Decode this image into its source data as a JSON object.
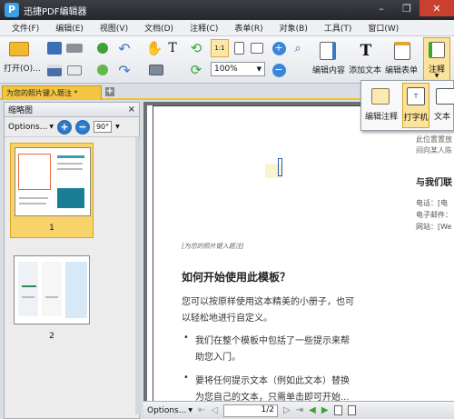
{
  "window": {
    "app_logo": "P",
    "title": "迅捷PDF编辑器"
  },
  "menu": [
    "文件(F)",
    "编辑(E)",
    "视图(V)",
    "文档(D)",
    "注释(C)",
    "表单(R)",
    "对象(B)",
    "工具(T)",
    "窗口(W)"
  ],
  "toolbar": {
    "open_label": "打开(O)...",
    "zoom_value": "100%",
    "edit_content_label": "编辑内容",
    "add_text_label": "添加文本",
    "edit_form_label": "编辑表单",
    "annotate_label": "注释"
  },
  "annotate_popup": {
    "edit_annotation_label": "编辑注释",
    "typewriter_label": "打字机",
    "text_label": "文本"
  },
  "tabs": {
    "active_tab": "为您的照片键入题注 *",
    "add_tab": "+"
  },
  "sidebar": {
    "title": "缩略图",
    "close": "×",
    "options_label": "Options...",
    "zoom_in": "+",
    "zoom_out": "−",
    "rotate_label": "90°",
    "thumbnails": [
      {
        "page": "1"
      },
      {
        "page": "2"
      }
    ]
  },
  "document": {
    "caption_placeholder": "[为您的照片键入题注]",
    "heading": "如何开始使用此模板？",
    "intro": [
      "您可以按原样使用这本精美的小册子，也可",
      "以轻松地进行自定义。"
    ],
    "bullets": [
      [
        "我们在整个模板中包括了一些提示来帮",
        "助您入门。"
      ],
      [
        "要将任何提示文本（例如此文本）替换",
        "为您自己的文本，只需单击即可开始..."
      ]
    ],
    "right_col_text": [
      "此位置置放",
      "间向某人陈"
    ],
    "contact_heading": "与我们联",
    "contact_lines": [
      "电话：[电",
      "电子邮件：",
      "网站：[We"
    ]
  },
  "statusbar": {
    "options_label": "Options...",
    "page_current": "1",
    "page_total": "2"
  }
}
